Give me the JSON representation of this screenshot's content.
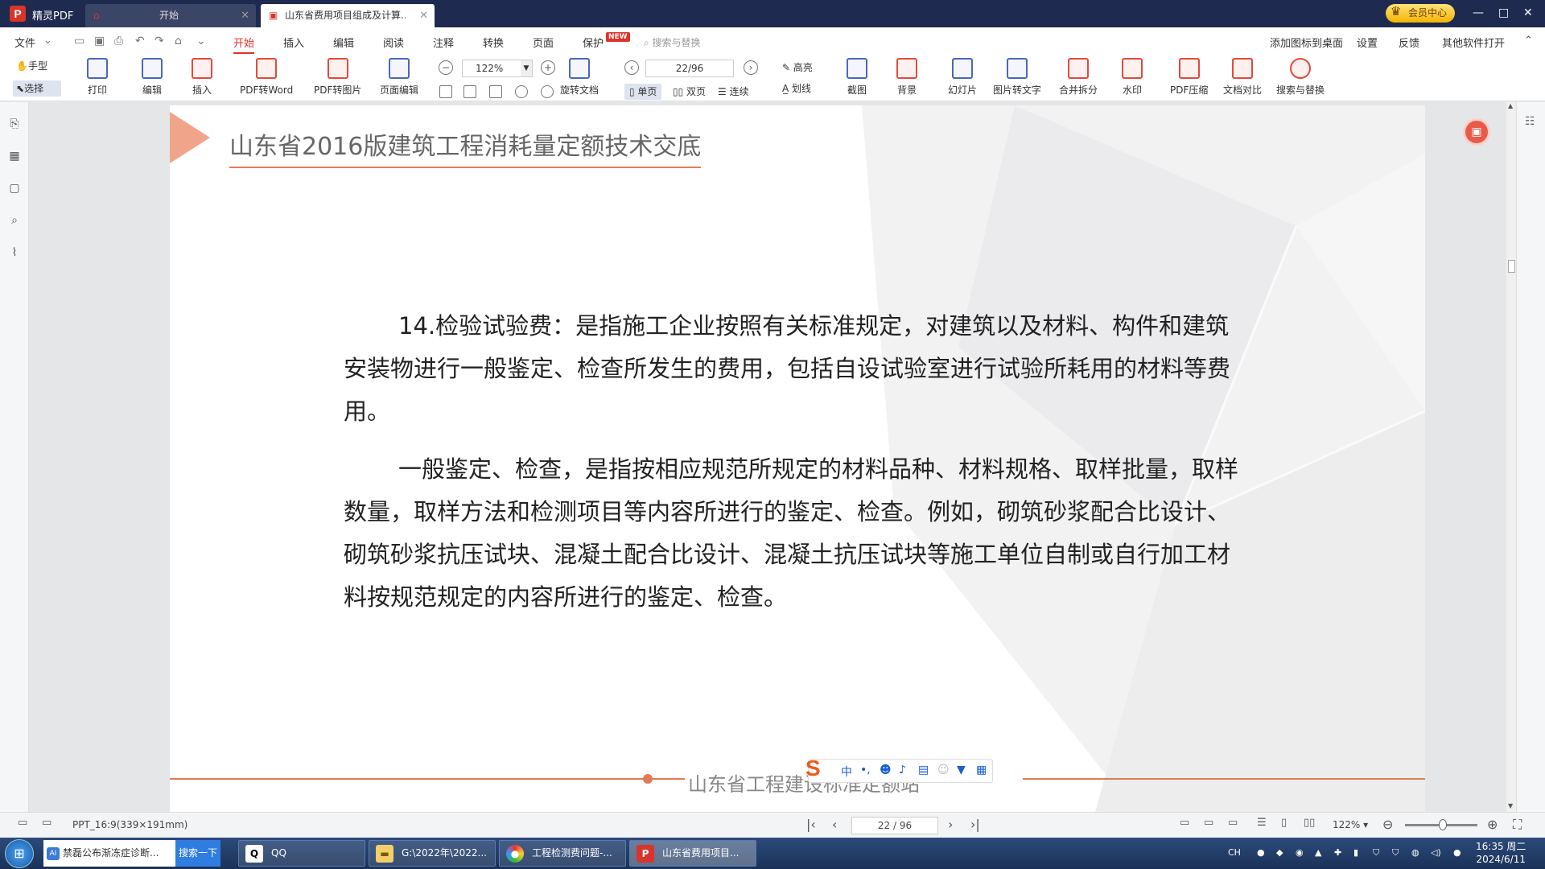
{
  "app": {
    "name": "精灵PDF"
  },
  "tabs": [
    {
      "label": "开始"
    },
    {
      "label": "山东省费用项目组成及计算..."
    }
  ],
  "vip": {
    "label": "会员中心"
  },
  "menu": {
    "file": "文件",
    "items": [
      "开始",
      "插入",
      "编辑",
      "阅读",
      "注释",
      "转换",
      "页面",
      "保护"
    ],
    "new_badge": "NEW",
    "search_placeholder": "搜索与替换",
    "right": [
      "添加图标到桌面",
      "设置",
      "反馈",
      "其他软件打开"
    ]
  },
  "toolbar": {
    "hand": "手型",
    "select": "选择",
    "print": "打印",
    "edit": "编辑",
    "insert": "插入",
    "pdf_to_word": "PDF转Word",
    "pdf_to_image": "PDF转图片",
    "page_edit": "页面编辑",
    "zoom": "122%",
    "page": "22/96",
    "rotate": "旋转文档",
    "single": "单页",
    "double": "双页",
    "continuous": "连续",
    "highlight": "高亮",
    "underline": "划线",
    "screenshot": "截图",
    "background": "背景",
    "slideshow": "幻灯片",
    "img_to_text": "图片转文字",
    "merge_split": "合并拆分",
    "watermark": "水印",
    "compress": "PDF压缩",
    "compare": "文档对比",
    "search_replace": "搜索与替换"
  },
  "document": {
    "title": "山东省2016版建筑工程消耗量定额技术交底",
    "para1": "14.检验试验费：是指施工企业按照有关标准规定，对建筑以及材料、构件和建筑安装物进行一般鉴定、检查所发生的费用，包括自设试验室进行试验所耗用的材料等费用。",
    "para2": "一般鉴定、检查，是指按相应规范所规定的材料品种、材料规格、取样批量，取样数量，取样方法和检测项目等内容所进行的鉴定、检查。例如，砌筑砂浆配合比设计、砌筑砂浆抗压试块、混凝土配合比设计、混凝土抗压试块等施工单位自制或自行加工材料按规范规定的内容所进行的鉴定、检查。",
    "footer": "山东省工程建设标准定额站"
  },
  "ime": {
    "mode": "中"
  },
  "status": {
    "page_size": "PPT_16:9(339×191mm)",
    "page": "22 / 96",
    "zoom": "122%"
  },
  "taskbar": {
    "search_text": "禁磊公布渐冻症诊断...",
    "search_btn": "搜索一下",
    "apps": [
      {
        "label": "QQ"
      },
      {
        "label": "G:\\2022年\\2022..."
      },
      {
        "label": "工程检测费问题-..."
      },
      {
        "label": "山东省费用项目..."
      }
    ],
    "lang": "CH",
    "time": "16:35 周二",
    "date": "2024/6/11"
  }
}
